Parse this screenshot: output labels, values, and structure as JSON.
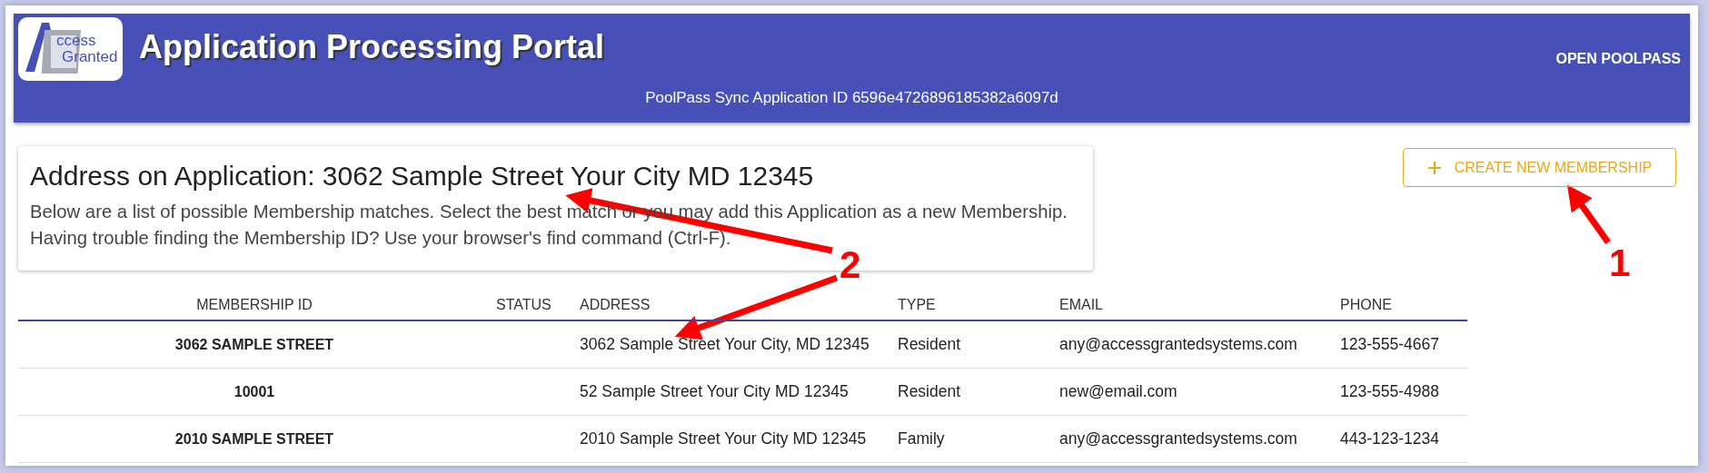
{
  "header": {
    "title": "Application Processing Portal",
    "logo_text": [
      "ccess",
      "Granted"
    ],
    "subtitle": "PoolPass Sync Application ID 6596e4726896185382a6097d",
    "link": "OPEN POOLPASS"
  },
  "card": {
    "heading": "Address on Application: 3062 Sample Street Your City MD 12345",
    "lines": [
      "Below are a list of possible Membership matches. Select the best match or you may add this Application as a new Membership.",
      "Having trouble finding the Membership ID? Use your browser's find command (Ctrl-F)."
    ]
  },
  "create_button": {
    "label": "CREATE NEW MEMBERSHIP"
  },
  "table": {
    "columns": [
      "MEMBERSHIP ID",
      "STATUS",
      "ADDRESS",
      "TYPE",
      "EMAIL",
      "PHONE"
    ],
    "rows": [
      {
        "membership_id": "3062 SAMPLE STREET",
        "address": "3062 Sample Street Your City, MD 12345",
        "type": "Resident",
        "email": "any@accessgrantedsystems.com",
        "phone": "123-555-4667"
      },
      {
        "membership_id": "10001",
        "address": "52 Sample Street Your City MD 12345",
        "type": "Resident",
        "email": "new@email.com",
        "phone": "123-555-4988"
      },
      {
        "membership_id": "2010 SAMPLE STREET",
        "address": "2010 Sample Street Your City MD 12345",
        "type": "Family",
        "email": "any@accessgrantedsystems.com",
        "phone": "443-123-1234"
      }
    ]
  },
  "annotations": [
    {
      "label": "2"
    },
    {
      "label": "1"
    }
  ]
}
